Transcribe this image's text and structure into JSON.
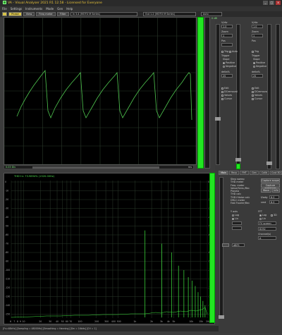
{
  "window": {
    "title": "VA - Visual Analyser 2021 R1 12.58 - Licensed for Everyone",
    "min": "_",
    "max": "□",
    "close": "x"
  },
  "menu": [
    "File",
    "Settings",
    "Instruments",
    "Mode",
    "Gen",
    "Help"
  ],
  "toolbar": {
    "buttons": [
      {
        "label": "Phase",
        "active": true
      },
      {
        "label": "View",
        "active": false
      },
      {
        "label": "Freq meter",
        "active": false
      },
      {
        "label": "Filter",
        "active": false
      }
    ],
    "input_device": "In 3-4 (MOTU M Series)",
    "output_device": "Out 1-2 (MOTU M Series)",
    "mode": "Auto"
  },
  "scope": {
    "bottom_left": "0.03 Div",
    "bottom_right": "ms",
    "side_left": "dB",
    "level_top": "0 dB",
    "level_bottom": "OL"
  },
  "scope_panel": {
    "vdiv_label": "V/div",
    "vdiv": "1.0",
    "zoom_label": "Zoom",
    "zoom": "1",
    "pos_label": "Pos",
    "trig_label": "Trig",
    "trig_auto": "Auto",
    "trigger_label": "Trigger",
    "slope_label": "Slope",
    "positive": "Positive",
    "negative": "Negative",
    "delta_label": "delta%",
    "delta": "25",
    "edit_label": "Edit",
    "dcremoval": "DCremoval",
    "values": "Values",
    "cursor": "Cursor"
  },
  "spectrum": {
    "thd_label": "THD+n: 73.9894%",
    "thd_freq": "(1520.00Hz)",
    "status": "[Fs=48kHz] [Sampling = 48000Hz] [Smoothing = Hanning] [Sm = 16bits] [CH = 1]",
    "x_ticks": [
      "6",
      "7",
      "8",
      "9",
      "10",
      "20",
      "30",
      "40",
      "50",
      "60",
      "70",
      "100",
      "200",
      "300",
      "400",
      "500",
      "1k",
      "2k",
      "3k",
      "4k",
      "5k",
      "10k",
      "15k",
      "20k"
    ],
    "y_ticks": [
      "0",
      "-10",
      "-20",
      "-30",
      "-40",
      "-50",
      "-60",
      "-70",
      "-80",
      "-90",
      "-100",
      "-110",
      "-120",
      "-130",
      "-140",
      "-150"
    ],
    "level_top": "dB"
  },
  "tabs": [
    "Main",
    "Recp",
    "FMT",
    "Gen",
    "Calib",
    "Cust 3D"
  ],
  "spec_panel": {
    "items": [
      "Step sweep",
      "THD meter",
      "Freq. meter",
      "Value/Sens./Rec",
      "Plasma",
      "THD calc",
      "THD+Noise calc",
      "DRLC meter",
      "Fast Fourier/Rec"
    ],
    "capture_scope": "Capture scope",
    "capture_spectrum": "Capture spectrum",
    "wave_label": "Wave",
    "wave_val": "Info",
    "freq_label": "f/wdg",
    "freq": "6.0",
    "smd": "smd",
    "smd_val": "6.0",
    "ax_label": "Y axis",
    "y_log": "Log",
    "y_lin": "Lin",
    "y_val": "3D",
    "fft_label": "FFT",
    "fft_size": "8192",
    "fftscreen": "FV screen",
    "channel_label": "Channel(s)",
    "channel": "A",
    "units": "dBFS",
    "window": "Hann"
  }
}
